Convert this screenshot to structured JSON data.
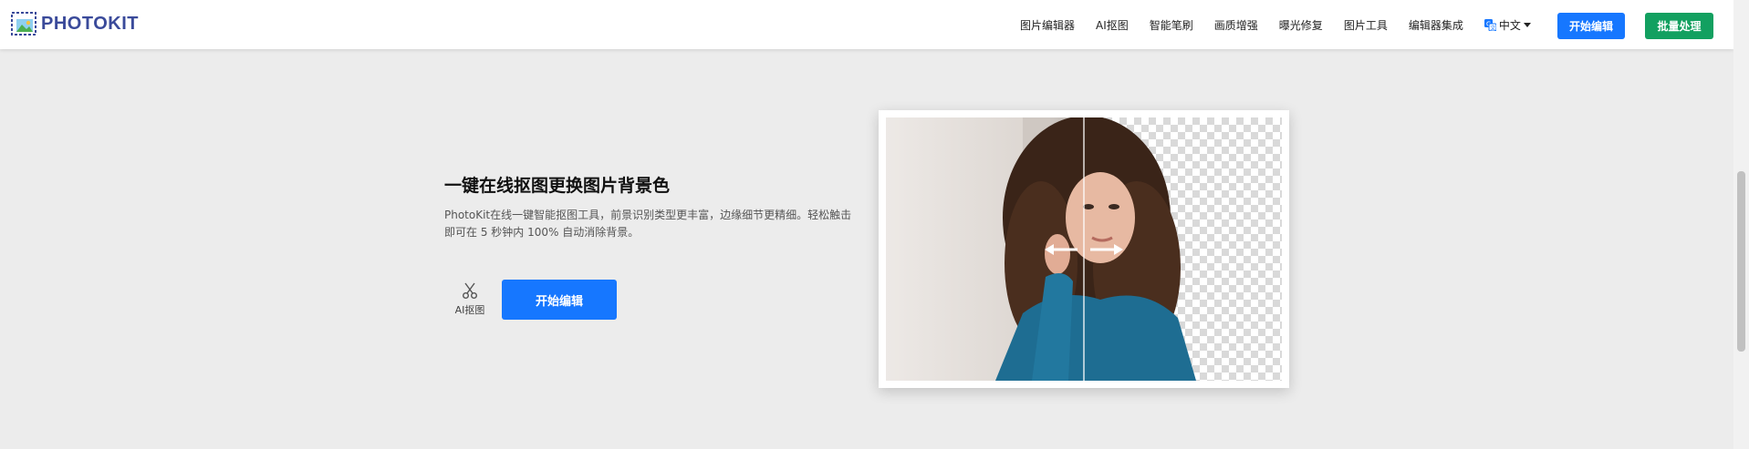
{
  "header": {
    "logo_text": "PHOTOKIT",
    "nav": [
      {
        "label": "图片编辑器"
      },
      {
        "label": "AI抠图"
      },
      {
        "label": "智能笔刷"
      },
      {
        "label": "画质增强"
      },
      {
        "label": "曝光修复"
      },
      {
        "label": "图片工具"
      },
      {
        "label": "编辑器集成"
      }
    ],
    "language": "中文",
    "start_button": "开始编辑",
    "batch_button": "批量处理"
  },
  "main": {
    "title": "一键在线抠图更换图片背景色",
    "description": "PhotoKit在线一键智能抠图工具，前景识别类型更丰富，边缘细节更精细。轻松触击即可在 5 秒钟内 100% 自动消除背景。",
    "tool_label": "AI抠图",
    "start_button": "开始编辑"
  },
  "icons": {
    "logo": "photokit-logo-icon",
    "language": "translate-icon",
    "language_caret": "caret-down-icon",
    "tool": "scissors-icon",
    "compare_left": "arrow-left-icon",
    "compare_right": "arrow-right-icon"
  },
  "colors": {
    "primary": "#1677ff",
    "batch": "#12a060",
    "logo_text": "#3a4a9a",
    "page_bg": "#ececec"
  }
}
